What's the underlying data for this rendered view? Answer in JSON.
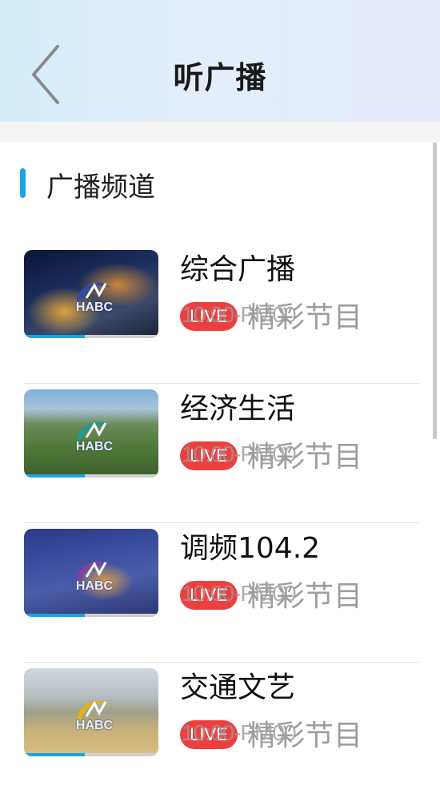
{
  "header": {
    "title": "听广播"
  },
  "section": {
    "title": "广播频道"
  },
  "colors": {
    "accent": "#1aa2e6",
    "live": "#ee3f3f"
  },
  "channels": [
    {
      "name": "综合广播",
      "live_label": "LIVE",
      "time": "10:00-PM00",
      "program": "精彩节目",
      "progress": 0.45,
      "logo": "HABC"
    },
    {
      "name": "经济生活",
      "live_label": "LIVE",
      "time": "10:00-PM00",
      "program": "精彩节目",
      "progress": 0.45,
      "logo": "HABC"
    },
    {
      "name": "调频104.2",
      "live_label": "LIVE",
      "time": "10:00-PM00",
      "program": "精彩节目",
      "progress": 0.45,
      "logo": "HABC"
    },
    {
      "name": "交通文艺",
      "live_label": "LIVE",
      "time": "10:00-PM00",
      "program": "精彩节目",
      "progress": 0.45,
      "logo": "HABC"
    }
  ]
}
